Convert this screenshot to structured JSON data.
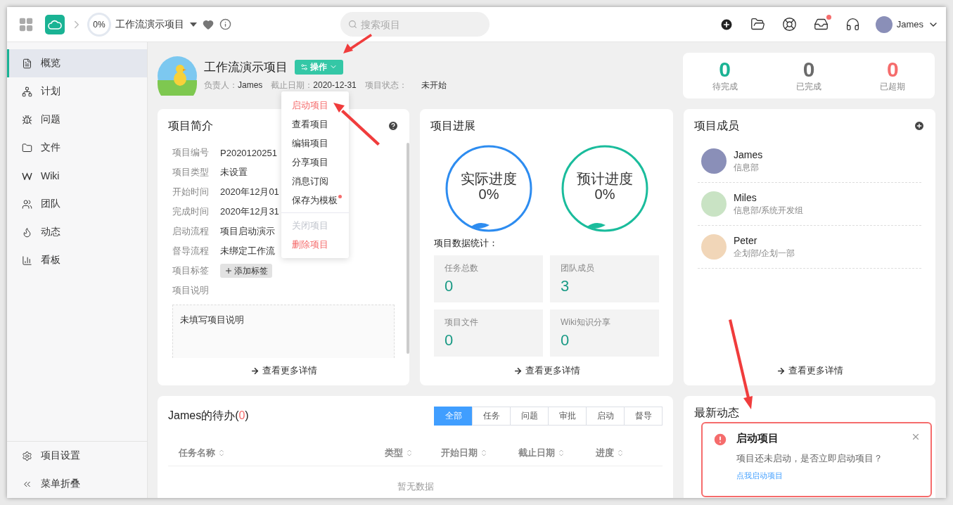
{
  "topbar": {
    "progress": "0%",
    "project_title": "工作流演示项目",
    "search": {
      "placeholder": "搜索项目"
    },
    "inbox_unread": true,
    "user": "James"
  },
  "sidebar": {
    "items": [
      {
        "label": "概览",
        "selected": true
      },
      {
        "label": "计划",
        "selected": false
      },
      {
        "label": "问题",
        "selected": false
      },
      {
        "label": "文件",
        "selected": false
      },
      {
        "label": "Wiki",
        "selected": false
      },
      {
        "label": "团队",
        "selected": false
      },
      {
        "label": "动态",
        "selected": false
      },
      {
        "label": "看板",
        "selected": false
      }
    ],
    "footer": [
      "项目设置",
      "菜单折叠"
    ]
  },
  "header": {
    "title": "工作流演示项目",
    "action_button": "操作",
    "owner_label": "负责人：",
    "owner": "James",
    "due_label": "截止日期：",
    "due": "2020-12-31",
    "status_label": "项目状态：",
    "status": "未开始"
  },
  "stats": [
    {
      "value": "0",
      "label": "待完成",
      "color": "#1ab394"
    },
    {
      "value": "0",
      "label": "已完成",
      "color": "#6b6b6b"
    },
    {
      "value": "0",
      "label": "已超期",
      "color": "#f56c6c"
    }
  ],
  "action_menu": {
    "groups": [
      [
        {
          "label": "启动项目",
          "kind": "danger",
          "dot": false
        },
        {
          "label": "查看项目",
          "kind": "normal",
          "dot": false
        },
        {
          "label": "编辑项目",
          "kind": "normal",
          "dot": false
        },
        {
          "label": "分享项目",
          "kind": "normal",
          "dot": false
        },
        {
          "label": "消息订阅",
          "kind": "normal",
          "dot": false
        },
        {
          "label": "保存为模板",
          "kind": "normal",
          "dot": true
        }
      ],
      [
        {
          "label": "关闭项目",
          "kind": "disabled",
          "dot": false
        },
        {
          "label": "删除项目",
          "kind": "danger",
          "dot": false
        }
      ]
    ]
  },
  "intro": {
    "title": "项目简介",
    "fields": [
      {
        "label": "项目编号",
        "value": "P2020120251",
        "kind": "text"
      },
      {
        "label": "项目类型",
        "value": "未设置",
        "kind": "text"
      },
      {
        "label": "开始时间",
        "value": "2020年12月01",
        "kind": "text"
      },
      {
        "label": "完成时间",
        "value": "2020年12月31",
        "kind": "text"
      },
      {
        "label": "启动流程",
        "value": "项目启动演示",
        "kind": "text"
      },
      {
        "label": "督导流程",
        "value": "未绑定工作流",
        "kind": "edit"
      },
      {
        "label": "项目标签",
        "value": "添加标签",
        "kind": "tag"
      }
    ],
    "description_label": "项目说明",
    "description": "未填写项目说明",
    "more": "查看更多详情"
  },
  "progress": {
    "title": "项目进展",
    "gauges": [
      {
        "label": "实际进度",
        "value": "0%",
        "color": "#2d8cf0"
      },
      {
        "label": "预计进度",
        "value": "0%",
        "color": "#1abc9c"
      }
    ],
    "stats_title": "项目数据统计：",
    "tiles": [
      {
        "label": "任务总数",
        "value": "0"
      },
      {
        "label": "团队成员",
        "value": "3"
      },
      {
        "label": "项目文件",
        "value": "0"
      },
      {
        "label": "Wiki知识分享",
        "value": "0"
      }
    ],
    "more": "查看更多详情"
  },
  "members": {
    "title": "项目成员",
    "list": [
      {
        "name": "James",
        "dept": "信息部"
      },
      {
        "name": "Miles",
        "dept": "信息部/系统开发组"
      },
      {
        "name": "Peter",
        "dept": "企划部/企划一部"
      }
    ],
    "more": "查看更多详情"
  },
  "todo": {
    "title": "James的待办(",
    "count": "0",
    "title_end": ")",
    "filters": [
      {
        "label": "全部",
        "selected": true
      },
      {
        "label": "任务",
        "selected": false
      },
      {
        "label": "问题",
        "selected": false
      },
      {
        "label": "审批",
        "selected": false
      },
      {
        "label": "启动",
        "selected": false
      },
      {
        "label": "督导",
        "selected": false
      }
    ],
    "columns": [
      "任务名称",
      "类型",
      "开始日期",
      "截止日期",
      "进度"
    ],
    "empty": "暂无数据"
  },
  "feed": {
    "title": "最新动态"
  },
  "toast": {
    "title": "启动项目",
    "message": "项目还未启动，是否立即启动项目？",
    "link": "点我启动项目"
  }
}
